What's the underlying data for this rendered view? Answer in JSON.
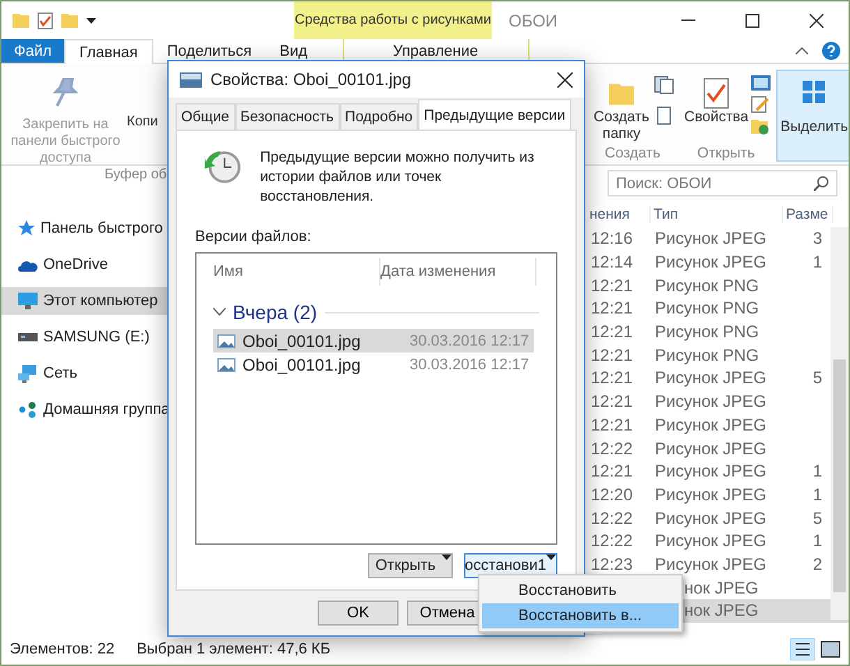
{
  "titlebar": {
    "context_label": "Средства работы с рисунками",
    "title": "ОБОИ"
  },
  "ribbon_tabs": [
    {
      "label": "Файл",
      "kind": "file",
      "selected": false
    },
    {
      "label": "Главная",
      "kind": "plain",
      "selected": true
    },
    {
      "label": "Поделиться",
      "kind": "plain",
      "selected": false
    },
    {
      "label": "Вид",
      "kind": "plain",
      "selected": false
    },
    {
      "label": "Управление",
      "kind": "context",
      "selected": false
    }
  ],
  "ribbon": {
    "pin_label": "Закрепить на панели быстрого доступа",
    "copy_label": "Копи",
    "clipboard_group": "Буфер об",
    "new_folder": "Создать папку",
    "create_group": "Создать",
    "properties": "Свойства",
    "open_group": "Открыть",
    "select": "Выделить"
  },
  "search": {
    "placeholder": "Поиск: ОБОИ"
  },
  "nav": [
    {
      "label": "Панель быстрого",
      "kind": "star",
      "selected": false
    },
    {
      "label": "OneDrive",
      "kind": "cloud",
      "selected": false
    },
    {
      "label": "Этот компьютер",
      "kind": "monitor",
      "selected": true
    },
    {
      "label": "SAMSUNG (E:)",
      "kind": "drive",
      "selected": false
    },
    {
      "label": "Сеть",
      "kind": "network",
      "selected": false
    },
    {
      "label": "Домашняя группа",
      "kind": "group",
      "selected": false
    }
  ],
  "columns": [
    "нения",
    "Тип",
    "Разме"
  ],
  "files": [
    {
      "time": "12:16",
      "type": "Рисунок JPEG",
      "size": "3",
      "selected": false
    },
    {
      "time": "12:14",
      "type": "Рисунок JPEG",
      "size": "1",
      "selected": false
    },
    {
      "time": "12:21",
      "type": "Рисунок PNG",
      "selected": false
    },
    {
      "time": "12:21",
      "type": "Рисунок PNG",
      "selected": false
    },
    {
      "time": "12:21",
      "type": "Рисунок PNG",
      "selected": false
    },
    {
      "time": "12:21",
      "type": "Рисунок PNG",
      "selected": false
    },
    {
      "time": "12:21",
      "type": "Рисунок JPEG",
      "size": "5",
      "selected": false
    },
    {
      "time": "12:21",
      "type": "Рисунок JPEG",
      "selected": false
    },
    {
      "time": "12:21",
      "type": "Рисунок JPEG",
      "selected": false
    },
    {
      "time": "12:22",
      "type": "Рисунок JPEG",
      "selected": false
    },
    {
      "time": "12:21",
      "type": "Рисунок JPEG",
      "size": "1",
      "selected": false
    },
    {
      "time": "12:20",
      "type": "Рисунок JPEG",
      "size": "1",
      "selected": false
    },
    {
      "time": "12:22",
      "type": "Рисунок JPEG",
      "size": "5",
      "selected": false
    },
    {
      "time": "12:22",
      "type": "Рисунок JPEG",
      "size": "1",
      "selected": false
    },
    {
      "time": "12:23",
      "type": "Рисунок JPEG",
      "size": "2",
      "selected": false
    },
    {
      "type": "нок JPEG",
      "selected": false
    },
    {
      "type": "нок JPEG",
      "selected": true
    }
  ],
  "status": {
    "count": "Элементов: 22",
    "selection": "Выбран 1 элемент: 47,6 КБ"
  },
  "dialog": {
    "title": "Свойства: Oboi_00101.jpg",
    "tabs": [
      {
        "label": "Общие",
        "selected": false
      },
      {
        "label": "Безопасность",
        "selected": false
      },
      {
        "label": "Подробно",
        "selected": false
      },
      {
        "label": "Предыдущие версии",
        "selected": true
      }
    ],
    "info": "Предыдущие версии можно получить из истории файлов или точек восстановления.",
    "versions_label": "Версии файлов:",
    "columns": [
      "Имя",
      "Дата изменения"
    ],
    "group": {
      "label": "Вчера (2)",
      "expanded": true
    },
    "versions": [
      {
        "name": "Oboi_00101.jpg",
        "date": "30.03.2016 12:17",
        "selected": true
      },
      {
        "name": "Oboi_00101.jpg",
        "date": "30.03.2016 12:17",
        "selected": false
      }
    ],
    "open_button": "Открыть",
    "restore_button": "осстанови1",
    "buttons": [
      "OK",
      "Отмена"
    ]
  },
  "menu": [
    {
      "label": "Восстановить",
      "selected": false
    },
    {
      "label": "Восстановить в...",
      "selected": true
    }
  ]
}
